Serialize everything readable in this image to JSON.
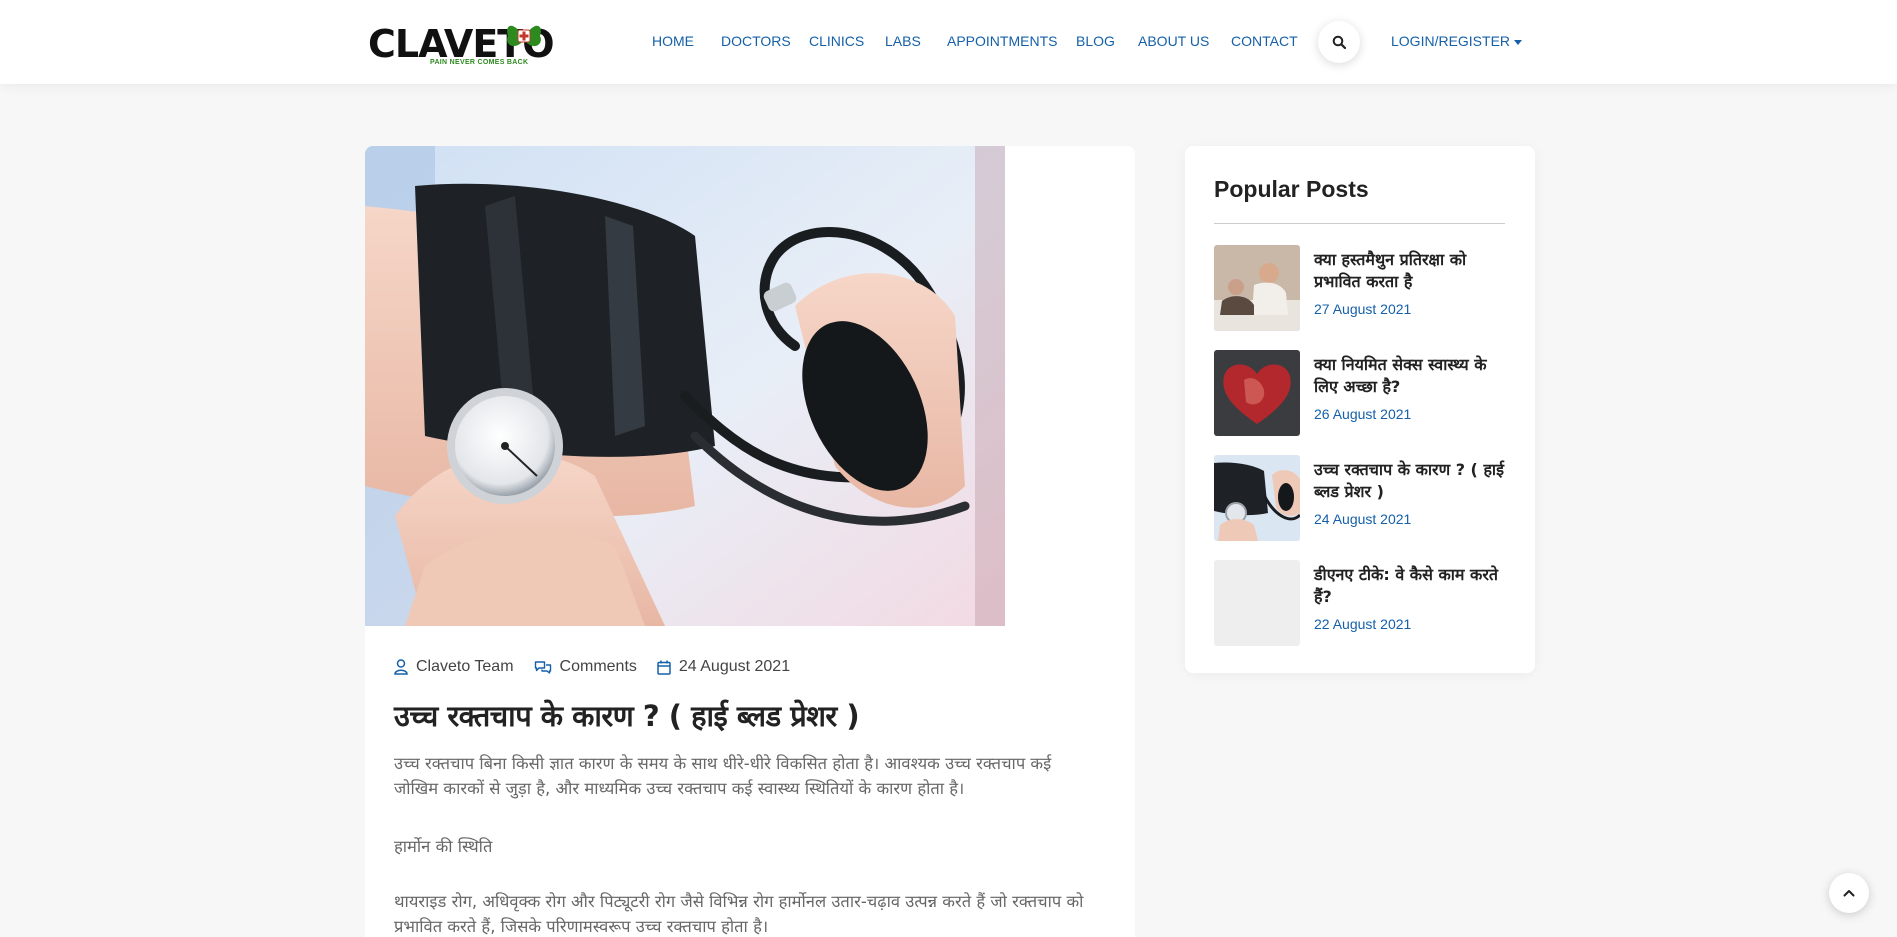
{
  "header": {
    "logo": {
      "text": "CLAVETO",
      "tagline": "PAIN NEVER COMES BACK"
    },
    "nav": [
      {
        "label": "HOME"
      },
      {
        "label": "DOCTORS"
      },
      {
        "label": "CLINICS"
      },
      {
        "label": "LABS"
      },
      {
        "label": "APPOINTMENTS"
      },
      {
        "label": "BLOG"
      },
      {
        "label": "ABOUT US"
      },
      {
        "label": "CONTACT"
      }
    ],
    "search_icon": "search-icon",
    "login_label": "LOGIN/REGISTER"
  },
  "article": {
    "image_icon": "blood-pressure-photo",
    "meta": {
      "author": "Claveto Team",
      "comments": "Comments",
      "date": "24 August 2021"
    },
    "title": "उच्च रक्तचाप के कारण ? ( हाई ब्लड प्रेशर )",
    "para1_line1": "उच्च रक्तचाप बिना किसी ज्ञात कारण के समय के साथ धीरे-धीरे विकसित होता है।  आवश्यक उच्च रक्तचाप कई",
    "para1_line2": "जोखिम कारकों से जुड़ा है, और माध्यमिक उच्च रक्तचाप कई स्वास्थ्य स्थितियों के कारण होता है।",
    "heading2": "हार्मोन की स्थिति",
    "para2_line1": " थायराइड रोग, अधिवृक्क रोग और पिट्यूटरी रोग जैसे विभिन्न रोग हार्मोनल उतार-चढ़ाव उत्पन्न करते हैं जो रक्तचाप को",
    "para2_line2": "प्रभावित करते हैं, जिसके परिणामस्वरूप उच्च रक्तचाप होता है।"
  },
  "sidebar": {
    "title": "Popular Posts",
    "posts": [
      {
        "title": "क्या हस्तमैथुन प्रतिरक्षा को प्रभावित करता है",
        "date": "27 August 2021"
      },
      {
        "title": "क्या नियमित सेक्स स्वास्थ्य के लिए अच्छा है?",
        "date": "26 August 2021"
      },
      {
        "title": "उच्च रक्तचाप के कारण ? ( हाई ब्लड प्रेशर )",
        "date": "24 August 2021"
      },
      {
        "title": "डीएनए टीके: वे कैसे काम करते हैं?",
        "date": "22 August 2021"
      }
    ]
  },
  "colors": {
    "accent": "#1560a8",
    "logo_green": "#2d8a1f",
    "background": "#f7f7f7"
  }
}
